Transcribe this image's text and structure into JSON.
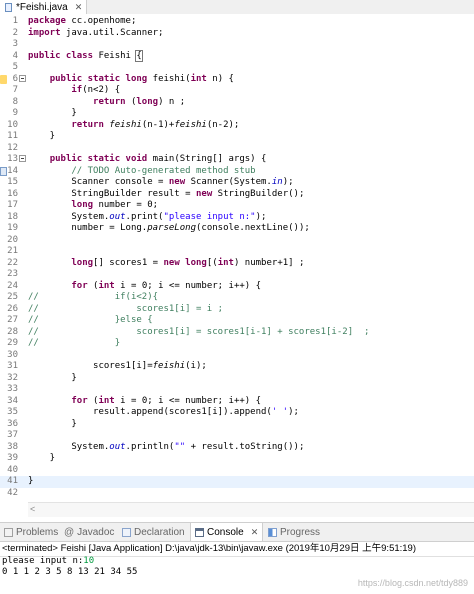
{
  "editor_tab": {
    "title": "*Feishi.java",
    "close": "✕"
  },
  "code_lines": [
    {
      "n": "1",
      "html": "<span class=\"kw\">package</span> cc.openhome;"
    },
    {
      "n": "2",
      "html": "<span class=\"kw\">import</span> java.util.Scanner;"
    },
    {
      "n": "3",
      "html": ""
    },
    {
      "n": "4",
      "html": "<span class=\"kw\">public class</span> Feishi <span class=\"bracket-box\">{</span>"
    },
    {
      "n": "5",
      "html": ""
    },
    {
      "n": "6",
      "html": "    <span class=\"kw\">public static long</span> feishi(<span class=\"kw\">int</span> n) {",
      "fold": true,
      "marker": "up"
    },
    {
      "n": "7",
      "html": "        <span class=\"kw\">if</span>(n&lt;2) {"
    },
    {
      "n": "8",
      "html": "            <span class=\"kw\">return</span> (<span class=\"kw\">long</span>) n ;"
    },
    {
      "n": "9",
      "html": "        }"
    },
    {
      "n": "10",
      "html": "        <span class=\"kw\">return</span> <span class=\"ita\">feishi</span>(n-1)+<span class=\"ita\">feishi</span>(n-2);"
    },
    {
      "n": "11",
      "html": "    }"
    },
    {
      "n": "12",
      "html": ""
    },
    {
      "n": "13",
      "html": "    <span class=\"kw\">public static void</span> main(String[] args) {",
      "fold": true
    },
    {
      "n": "14",
      "html": "        <span class=\"cmt\">// TODO Auto-generated method stub</span>",
      "marker": "task"
    },
    {
      "n": "15",
      "html": "        Scanner console = <span class=\"kw\">new</span> Scanner(System.<span class=\"fld ita\">in</span>);"
    },
    {
      "n": "16",
      "html": "        StringBuilder result = <span class=\"kw\">new</span> StringBuilder();"
    },
    {
      "n": "17",
      "html": "        <span class=\"kw\">long</span> number = 0;"
    },
    {
      "n": "18",
      "html": "        System.<span class=\"fld ita\">out</span>.print(<span class=\"str\">\"please input n:\"</span>);"
    },
    {
      "n": "19",
      "html": "        number = Long.<span class=\"ita\">parseLong</span>(console.nextLine());"
    },
    {
      "n": "20",
      "html": ""
    },
    {
      "n": "21",
      "html": ""
    },
    {
      "n": "22",
      "html": "        <span class=\"kw\">long</span>[] scores1 = <span class=\"kw\">new long</span>[(<span class=\"kw\">int</span>) number+1] ;"
    },
    {
      "n": "23",
      "html": ""
    },
    {
      "n": "24",
      "html": "        <span class=\"kw\">for</span> (<span class=\"kw\">int</span> i = 0; i &lt;= number; i++) {"
    },
    {
      "n": "25",
      "html": "<span class=\"cmt\">//              if(i&lt;2){</span>"
    },
    {
      "n": "26",
      "html": "<span class=\"cmt\">//                  scores1[i] = i ;</span>"
    },
    {
      "n": "27",
      "html": "<span class=\"cmt\">//              }else {</span>"
    },
    {
      "n": "28",
      "html": "<span class=\"cmt\">//                  scores1[i] = scores1[i-1] + scores1[i-2]  ;</span>"
    },
    {
      "n": "29",
      "html": "<span class=\"cmt\">//              }</span>"
    },
    {
      "n": "30",
      "html": ""
    },
    {
      "n": "31",
      "html": "            scores1[i]=<span class=\"ita\">feishi</span>(i);"
    },
    {
      "n": "32",
      "html": "        }"
    },
    {
      "n": "33",
      "html": ""
    },
    {
      "n": "34",
      "html": "        <span class=\"kw\">for</span> (<span class=\"kw\">int</span> i = 0; i &lt;= number; i++) {"
    },
    {
      "n": "35",
      "html": "            result.append(scores1[i]).append(<span class=\"str\">' '</span>);"
    },
    {
      "n": "36",
      "html": "        }"
    },
    {
      "n": "37",
      "html": ""
    },
    {
      "n": "38",
      "html": "        System.<span class=\"fld ita\">out</span>.println(<span class=\"str\">\"\"</span> + result.toString());"
    },
    {
      "n": "39",
      "html": "    }"
    },
    {
      "n": "40",
      "html": ""
    },
    {
      "n": "41",
      "html": "}",
      "current": true
    },
    {
      "n": "42",
      "html": ""
    }
  ],
  "bottom_tabs": [
    {
      "label": "Problems",
      "icon": "problems-icon"
    },
    {
      "label": "Javadoc",
      "icon": "javadoc-icon",
      "glyph": "@"
    },
    {
      "label": "Declaration",
      "icon": "declaration-icon"
    },
    {
      "label": "Console",
      "icon": "console-icon",
      "active": true,
      "close": "✕"
    },
    {
      "label": "Progress",
      "icon": "progress-icon"
    }
  ],
  "console": {
    "status": "<terminated> Feishi [Java Application] D:\\java\\jdk-13\\bin\\javaw.exe (2019年10月29日 上午9:51:19)",
    "prompt": "please input n:",
    "input": "10",
    "output": "0 1 1 2 3 5 8 13 21 34 55"
  },
  "watermark": "https://blog.csdn.net/tdy889"
}
